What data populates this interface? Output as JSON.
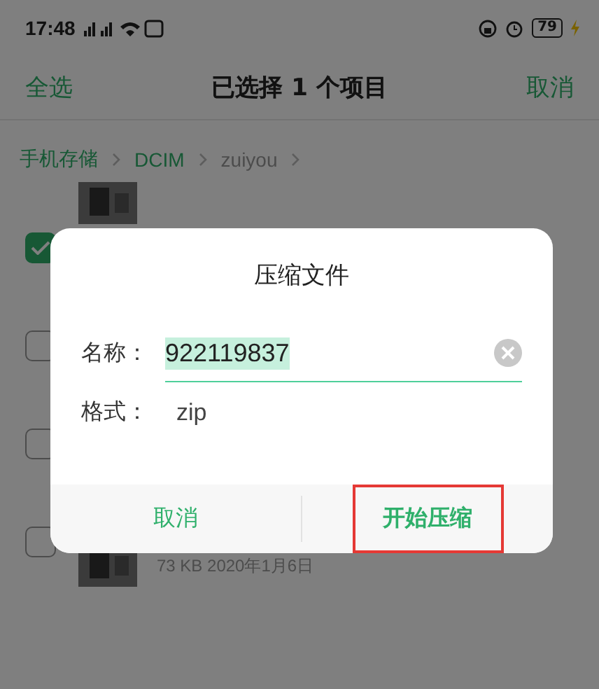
{
  "status_bar": {
    "time": "17:48",
    "battery": "79"
  },
  "header": {
    "select_all": "全选",
    "title": "已选择 1 个项目",
    "cancel": "取消"
  },
  "breadcrumb": [
    "手机存储",
    "DCIM",
    "zuiyou"
  ],
  "files": [
    {
      "checked": true,
      "thumbnail": true
    },
    {
      "checked": false
    },
    {
      "checked": false
    },
    {
      "checked": false,
      "thumbnail": true,
      "meta": "73 KB  2020年1月6日"
    }
  ],
  "dialog": {
    "title": "压缩文件",
    "fields": [
      {
        "kind": "input",
        "label": "名称：",
        "value": "922119837",
        "selected": true
      },
      {
        "kind": "text",
        "label": "格式：",
        "value": "zip"
      }
    ],
    "buttons": [
      {
        "label": "取消",
        "highlighted": false
      },
      {
        "label": "开始压缩",
        "highlighted": true
      }
    ]
  }
}
